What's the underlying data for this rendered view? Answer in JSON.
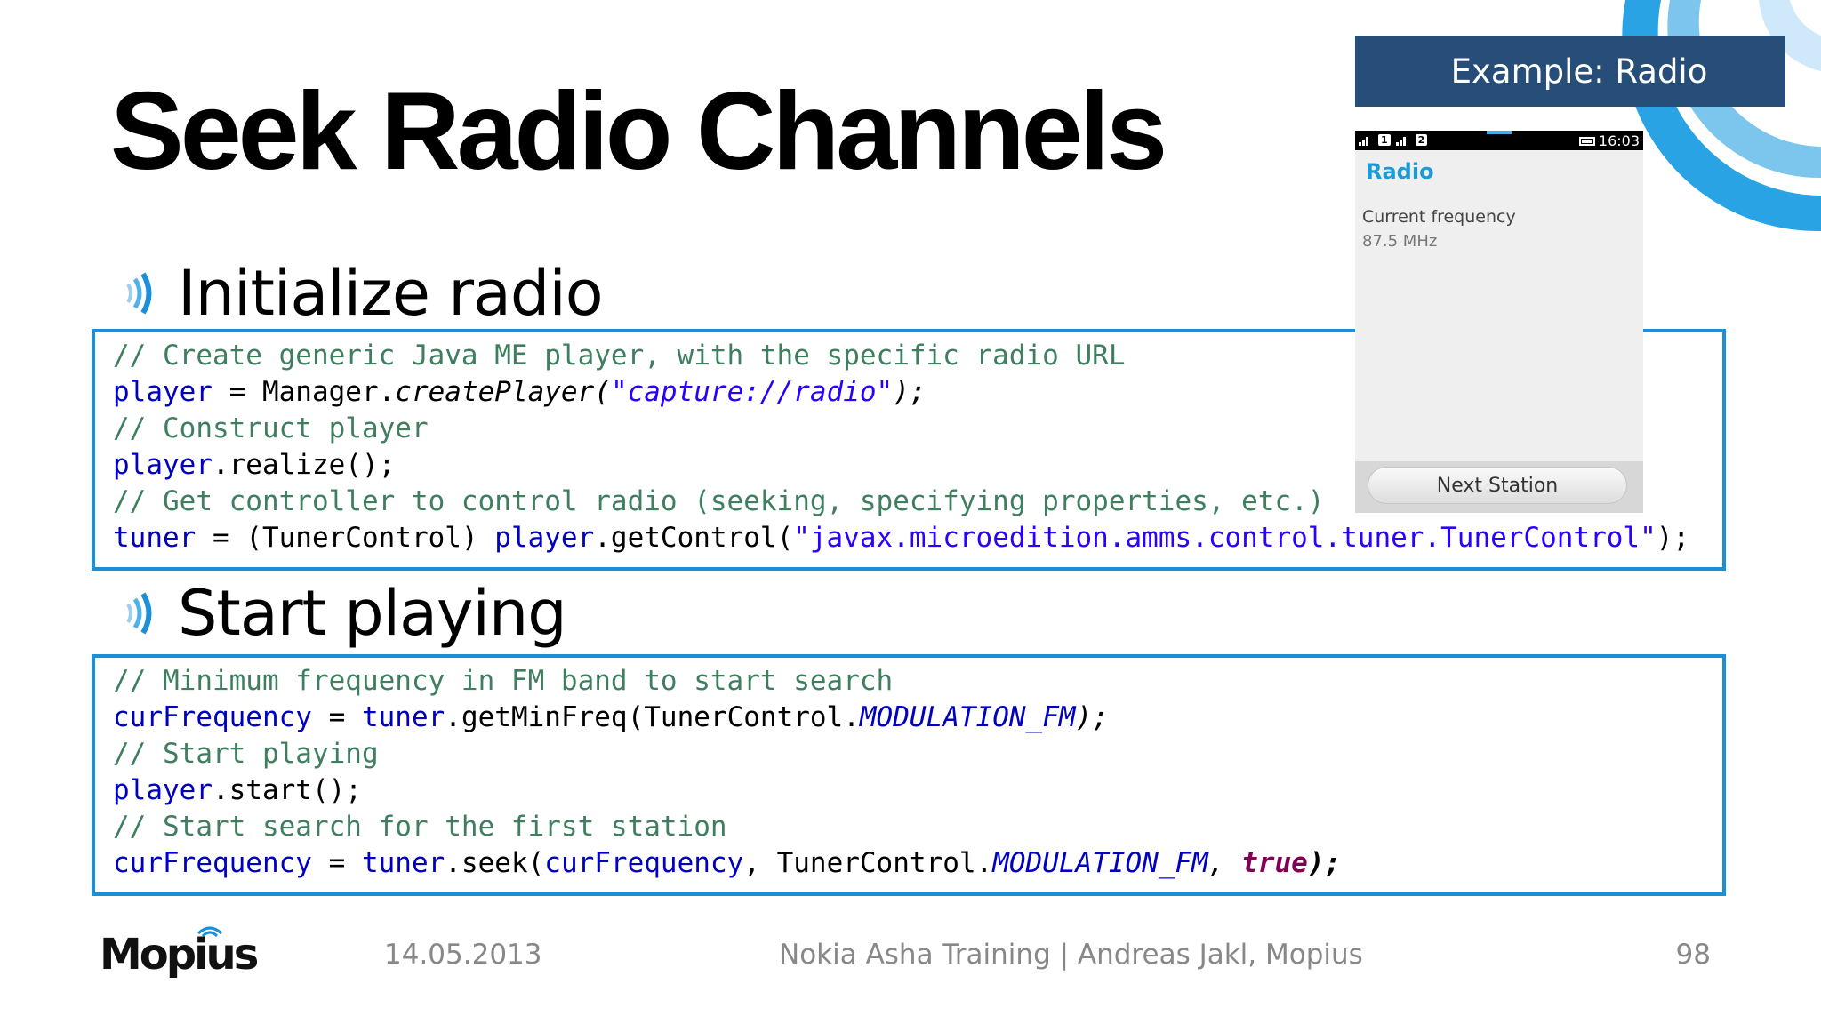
{
  "slide": {
    "title": "Seek Radio Channels",
    "bullets": [
      "Initialize radio",
      "Start playing"
    ]
  },
  "code_block_1": {
    "line1": "// Create generic Java ME player, with the specific radio URL",
    "line2_var": "player",
    "line2_mid": " = Manager.",
    "line2_method": "createPlayer(",
    "line2_string": "\"capture://radio\"",
    "line2_end": ");",
    "line3": "// Construct player",
    "line4_var": "player",
    "line4_end": ".realize();",
    "line5": "// Get controller to control radio (seeking, specifying properties, etc.)",
    "line6_var": "tuner",
    "line6_mid": " = (TunerControl) ",
    "line6_var2": "player",
    "line6_call": ".getControl(",
    "line6_string": "\"javax.microedition.amms.control.tuner.TunerControl\"",
    "line6_end": ");"
  },
  "code_block_2": {
    "line1": "// Minimum frequency in FM band to start search",
    "line2_var": "curFrequency",
    "line2_mid": " = ",
    "line2_var2": "tuner",
    "line2_call": ".getMinFreq(TunerControl.",
    "line2_const": "MODULATION_FM",
    "line2_end": ");",
    "line3": "// Start playing",
    "line4_var": "player",
    "line4_end": ".start();",
    "line5": "// Start search for the first station",
    "line6_var": "curFrequency",
    "line6_mid": " = ",
    "line6_var2": "tuner",
    "line6_call": ".seek(",
    "line6_var3": "curFrequency",
    "line6_mid2": ", TunerControl.",
    "line6_const": "MODULATION_FM",
    "line6_comma": ", ",
    "line6_keyword": "true",
    "line6_end": ");"
  },
  "example_panel": {
    "header": "Example: Radio",
    "status": {
      "sim1": "1",
      "sim2": "2",
      "time": "16:03"
    },
    "app_title": "Radio",
    "label": "Current frequency",
    "value": "87.5 MHz",
    "button": "Next Station"
  },
  "footer": {
    "logo": "Mopius",
    "date": "14.05.2013",
    "credit": "Nokia Asha Training | Andreas Jakl, Mopius",
    "page": "98"
  },
  "colors": {
    "accent_blue": "#1b8fd7",
    "header_navy": "#264e78",
    "comment": "#3f7f5f",
    "field": "#0000c0",
    "string": "#2a00ff",
    "keyword": "#7f0055"
  }
}
